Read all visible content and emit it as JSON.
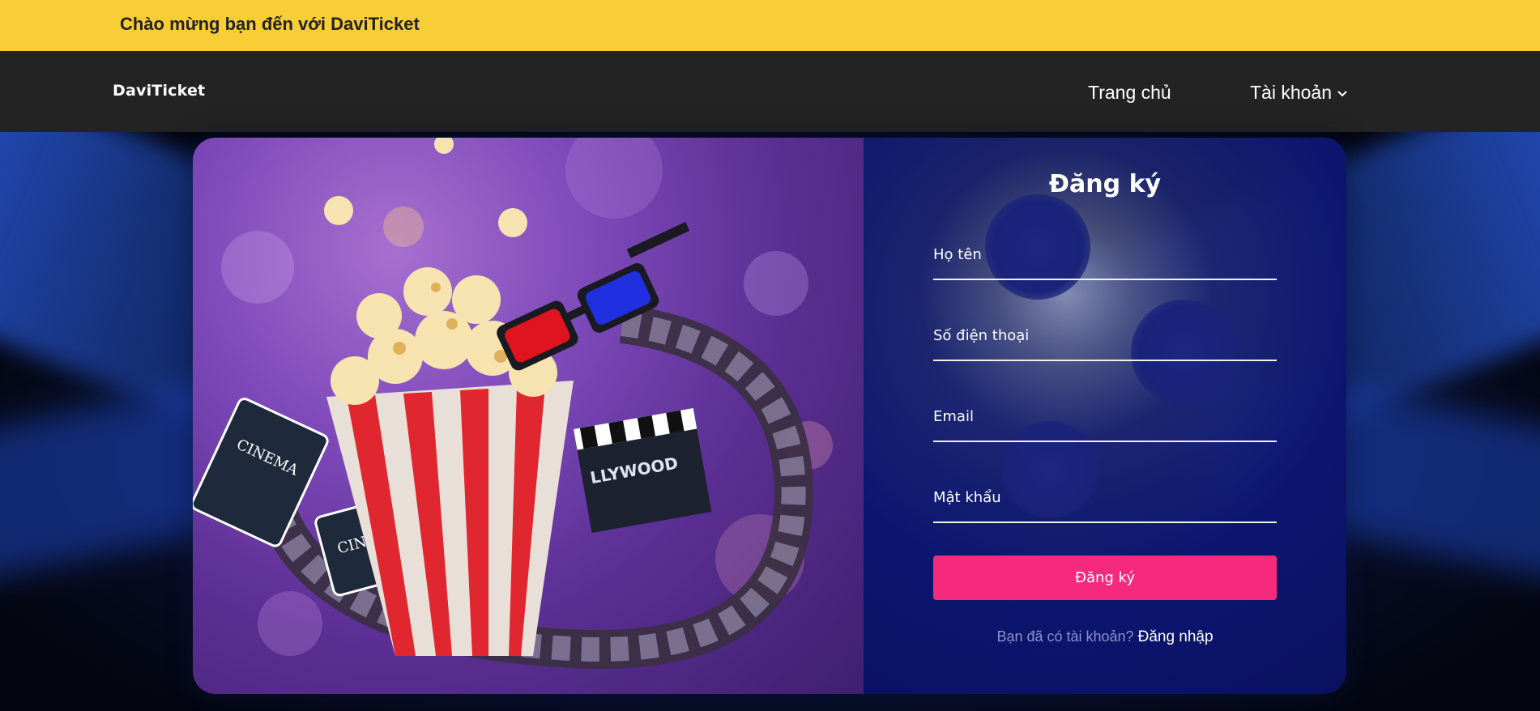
{
  "topbar": {
    "welcome": "Chào mừng bạn đến với DaviTicket"
  },
  "navbar": {
    "logo": "DaviTicket",
    "home": "Trang chủ",
    "account": "Tài khoản"
  },
  "form": {
    "title": "Đăng ký",
    "fields": [
      {
        "label": "Họ tên"
      },
      {
        "label": "Số điện thoại"
      },
      {
        "label": "Email"
      },
      {
        "label": "Mật khẩu"
      }
    ],
    "submit": "Đăng ký",
    "has_account": "Bạn đã có tài khoản?",
    "login_link": "Đăng nhập"
  },
  "colors": {
    "topbar": "#f8cd35",
    "navbar": "#232323",
    "submit": "#f52a7d"
  }
}
